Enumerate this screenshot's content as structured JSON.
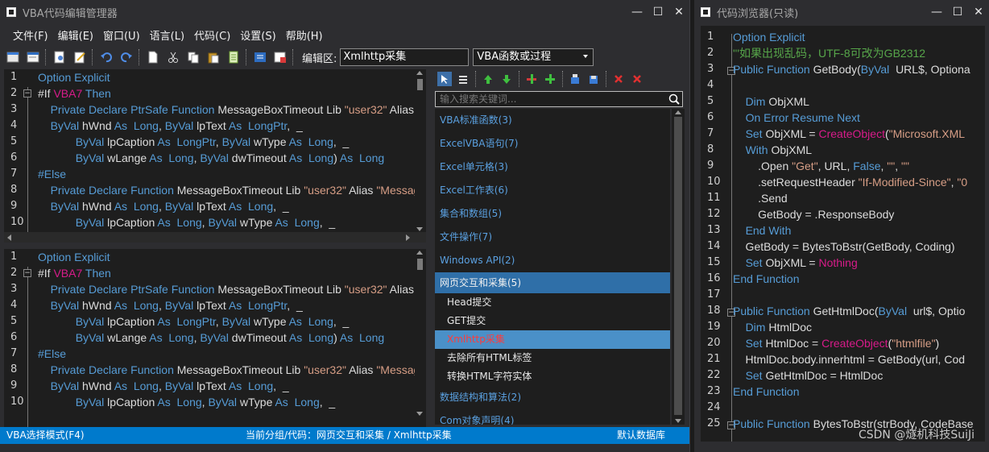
{
  "main_window": {
    "title": "VBA代码编辑管理器",
    "menu": [
      "文件(F)",
      "编辑(E)",
      "窗口(U)",
      "语言(L)",
      "代码(C)",
      "设置(S)",
      "帮助(H)"
    ],
    "toolbar": {
      "edit_area_label": "编辑区:",
      "edit_area_value": "Xmlhttp采集",
      "function_select": "VBA函数或过程",
      "icons": [
        "new-doc",
        "open",
        "undo-like",
        "edit",
        "undo",
        "redo",
        "paste-doc",
        "cut",
        "copy",
        "paste",
        "notes",
        "format",
        "export"
      ]
    },
    "editor": {
      "line_numbers": [
        "1",
        "2",
        "3",
        "4",
        "5",
        "6",
        "7",
        "8",
        "9",
        "10"
      ],
      "lines": [
        [
          {
            "c": "kw",
            "t": "Option Explicit"
          }
        ],
        [
          {
            "c": "t",
            "t": "#If "
          },
          {
            "c": "pk",
            "t": "VBA7"
          },
          {
            "c": "kw",
            "t": " Then"
          }
        ],
        [
          {
            "c": "t",
            "t": "    "
          },
          {
            "c": "kw",
            "t": "Private Declare PtrSafe Function"
          },
          {
            "c": "t",
            "t": " MessageBoxTimeout Lib "
          },
          {
            "c": "str",
            "t": "\"user32\""
          },
          {
            "c": "t",
            "t": " Alias "
          },
          {
            "c": "str",
            "t": "\""
          }
        ],
        [
          {
            "c": "t",
            "t": "    "
          },
          {
            "c": "kw",
            "t": "ByVal"
          },
          {
            "c": "t",
            "t": " hWnd "
          },
          {
            "c": "kw",
            "t": "As  Long"
          },
          {
            "c": "t",
            "t": ", "
          },
          {
            "c": "kw",
            "t": "ByVal"
          },
          {
            "c": "t",
            "t": " lpText "
          },
          {
            "c": "kw",
            "t": "As  LongPtr"
          },
          {
            "c": "t",
            "t": ",  _"
          }
        ],
        [
          {
            "c": "t",
            "t": "            "
          },
          {
            "c": "kw",
            "t": "ByVal"
          },
          {
            "c": "t",
            "t": " lpCaption "
          },
          {
            "c": "kw",
            "t": "As  LongPtr"
          },
          {
            "c": "t",
            "t": ", "
          },
          {
            "c": "kw",
            "t": "ByVal"
          },
          {
            "c": "t",
            "t": " wType "
          },
          {
            "c": "kw",
            "t": "As  Long"
          },
          {
            "c": "t",
            "t": ",  _"
          }
        ],
        [
          {
            "c": "t",
            "t": "            "
          },
          {
            "c": "kw",
            "t": "ByVal"
          },
          {
            "c": "t",
            "t": " wLange "
          },
          {
            "c": "kw",
            "t": "As  Long"
          },
          {
            "c": "t",
            "t": ", "
          },
          {
            "c": "kw",
            "t": "ByVal"
          },
          {
            "c": "t",
            "t": " dwTimeout "
          },
          {
            "c": "kw",
            "t": "As  Long"
          },
          {
            "c": "t",
            "t": ") "
          },
          {
            "c": "kw",
            "t": "As  Long"
          }
        ],
        [
          {
            "c": "kw",
            "t": "#Else"
          }
        ],
        [
          {
            "c": "t",
            "t": "    "
          },
          {
            "c": "kw",
            "t": "Private Declare Function"
          },
          {
            "c": "t",
            "t": " MessageBoxTimeout Lib "
          },
          {
            "c": "str",
            "t": "\"user32\""
          },
          {
            "c": "t",
            "t": " Alias "
          },
          {
            "c": "str",
            "t": "\"Messag"
          }
        ],
        [
          {
            "c": "t",
            "t": "    "
          },
          {
            "c": "kw",
            "t": "ByVal"
          },
          {
            "c": "t",
            "t": " hWnd "
          },
          {
            "c": "kw",
            "t": "As  Long"
          },
          {
            "c": "t",
            "t": ", "
          },
          {
            "c": "kw",
            "t": "ByVal"
          },
          {
            "c": "t",
            "t": " lpText "
          },
          {
            "c": "kw",
            "t": "As  Long"
          },
          {
            "c": "t",
            "t": ",  _"
          }
        ],
        [
          {
            "c": "t",
            "t": "            "
          },
          {
            "c": "kw",
            "t": "ByVal"
          },
          {
            "c": "t",
            "t": " lpCaption "
          },
          {
            "c": "kw",
            "t": "As  Long"
          },
          {
            "c": "t",
            "t": ", "
          },
          {
            "c": "kw",
            "t": "ByVal"
          },
          {
            "c": "t",
            "t": " wType "
          },
          {
            "c": "kw",
            "t": "As  Long"
          },
          {
            "c": "t",
            "t": ",  _"
          }
        ]
      ]
    },
    "tree": {
      "search_placeholder": "输入搜索关键词...",
      "items": [
        {
          "label": "VBA标准函数(3)",
          "level": 0
        },
        {
          "label": "ExcelVBA语句(7)",
          "level": 0
        },
        {
          "label": "Excel单元格(3)",
          "level": 0
        },
        {
          "label": "Excel工作表(6)",
          "level": 0
        },
        {
          "label": "集合和数组(5)",
          "level": 0
        },
        {
          "label": "文件操作(7)",
          "level": 0
        },
        {
          "label": "Windows API(2)",
          "level": 0
        },
        {
          "label": "网页交互和采集(5)",
          "level": 0,
          "selected": true
        },
        {
          "label": "Head提交",
          "level": 1
        },
        {
          "label": "GET提交",
          "level": 1
        },
        {
          "label": "Xmlhttp采集",
          "level": 1,
          "selected": true
        },
        {
          "label": "去除所有HTML标签",
          "level": 1
        },
        {
          "label": "转换HTML字符实体",
          "level": 1
        },
        {
          "label": "数据结构和算法(2)",
          "level": 0
        },
        {
          "label": "Com对象声明(4)",
          "level": 0
        }
      ]
    },
    "status": {
      "mode": "VBA选择模式(F4)",
      "current": "当前分组/代码：网页交互和采集  / Xmlhttp采集",
      "db": "默认数据库"
    }
  },
  "browser_window": {
    "title": "代码浏览器(只读)",
    "line_numbers": [
      "1",
      "2",
      "3",
      "4",
      "5",
      "6",
      "7",
      "8",
      "9",
      "10",
      "11",
      "12",
      "13",
      "14",
      "15",
      "16",
      "17",
      "18",
      "19",
      "20",
      "21",
      "22",
      "23",
      "24",
      "25"
    ],
    "lines": [
      [
        {
          "c": "kw",
          "t": "Option Explicit"
        }
      ],
      [
        {
          "c": "cm",
          "t": "'''如果出现乱码，UTF-8可改为GB2312"
        }
      ],
      [
        {
          "c": "kw",
          "t": "Public Function"
        },
        {
          "c": "t",
          "t": " GetBody("
        },
        {
          "c": "kw",
          "t": "ByVal"
        },
        {
          "c": "t",
          "t": "  URL$, Optiona"
        }
      ],
      [
        {
          "c": "t",
          "t": ""
        }
      ],
      [
        {
          "c": "t",
          "t": "    "
        },
        {
          "c": "kw",
          "t": "Dim"
        },
        {
          "c": "t",
          "t": " ObjXML"
        }
      ],
      [
        {
          "c": "t",
          "t": "    "
        },
        {
          "c": "kw",
          "t": "On Error Resume Next"
        }
      ],
      [
        {
          "c": "t",
          "t": "    "
        },
        {
          "c": "kw",
          "t": "Set"
        },
        {
          "c": "t",
          "t": " ObjXML = "
        },
        {
          "c": "pk",
          "t": "CreateObject"
        },
        {
          "c": "t",
          "t": "("
        },
        {
          "c": "str",
          "t": "\"Microsoft.XML"
        }
      ],
      [
        {
          "c": "t",
          "t": "    "
        },
        {
          "c": "kw",
          "t": "With"
        },
        {
          "c": "t",
          "t": " ObjXML"
        }
      ],
      [
        {
          "c": "t",
          "t": "        .Open "
        },
        {
          "c": "str",
          "t": "\"Get\""
        },
        {
          "c": "t",
          "t": ", URL, "
        },
        {
          "c": "kw",
          "t": "False"
        },
        {
          "c": "t",
          "t": ", "
        },
        {
          "c": "str",
          "t": "\"\""
        },
        {
          "c": "t",
          "t": ", "
        },
        {
          "c": "str",
          "t": "\"\""
        }
      ],
      [
        {
          "c": "t",
          "t": "        .setRequestHeader "
        },
        {
          "c": "str",
          "t": "\"If-Modified-Since\""
        },
        {
          "c": "t",
          "t": ", "
        },
        {
          "c": "str",
          "t": "\"0"
        }
      ],
      [
        {
          "c": "t",
          "t": "        .Send"
        }
      ],
      [
        {
          "c": "t",
          "t": "        GetBody = .ResponseBody"
        }
      ],
      [
        {
          "c": "t",
          "t": "    "
        },
        {
          "c": "kw",
          "t": "End With"
        }
      ],
      [
        {
          "c": "t",
          "t": "    GetBody = BytesToBstr(GetBody, Coding)"
        }
      ],
      [
        {
          "c": "t",
          "t": "    "
        },
        {
          "c": "kw",
          "t": "Set"
        },
        {
          "c": "t",
          "t": " ObjXML = "
        },
        {
          "c": "pk",
          "t": "Nothing"
        }
      ],
      [
        {
          "c": "kw",
          "t": "End Function"
        }
      ],
      [
        {
          "c": "t",
          "t": ""
        }
      ],
      [
        {
          "c": "kw",
          "t": "Public Function"
        },
        {
          "c": "t",
          "t": " GetHtmlDoc("
        },
        {
          "c": "kw",
          "t": "ByVal"
        },
        {
          "c": "t",
          "t": "  url$, Optio"
        }
      ],
      [
        {
          "c": "t",
          "t": "    "
        },
        {
          "c": "kw",
          "t": "Dim"
        },
        {
          "c": "t",
          "t": " HtmlDoc"
        }
      ],
      [
        {
          "c": "t",
          "t": "    "
        },
        {
          "c": "kw",
          "t": "Set"
        },
        {
          "c": "t",
          "t": " HtmlDoc = "
        },
        {
          "c": "pk",
          "t": "CreateObject"
        },
        {
          "c": "t",
          "t": "("
        },
        {
          "c": "str",
          "t": "\"htmlfile\""
        },
        {
          "c": "t",
          "t": ")"
        }
      ],
      [
        {
          "c": "t",
          "t": "    HtmlDoc.body.innerhtml = GetBody(url, Cod"
        }
      ],
      [
        {
          "c": "t",
          "t": "    "
        },
        {
          "c": "kw",
          "t": "Set"
        },
        {
          "c": "t",
          "t": " GetHtmlDoc = HtmlDoc"
        }
      ],
      [
        {
          "c": "kw",
          "t": "End Function"
        }
      ],
      [
        {
          "c": "t",
          "t": ""
        }
      ],
      [
        {
          "c": "kw",
          "t": "Public Function"
        },
        {
          "c": "t",
          "t": " BytesToBstr(strBody, CodeBase"
        }
      ]
    ],
    "watermark": "CSDN @燧机科技SuiJi"
  },
  "colors": {
    "keyword": "#569cd6",
    "string": "#d69d85",
    "comment": "#57a64a",
    "highlight": "#d81b8a",
    "status": "#007acc",
    "selected": "#2f6fa8"
  }
}
